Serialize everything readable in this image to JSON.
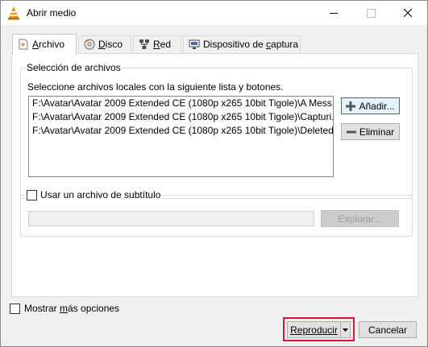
{
  "window": {
    "title": "Abrir medio",
    "icon": "vlc-cone-icon"
  },
  "tabs": [
    {
      "pre": "",
      "mnemonic": "A",
      "post": "rchivo",
      "icon": "file-play-icon",
      "active": true
    },
    {
      "pre": "",
      "mnemonic": "D",
      "post": "isco",
      "icon": "disc-icon",
      "active": false
    },
    {
      "pre": "",
      "mnemonic": "R",
      "post": "ed",
      "icon": "network-icon",
      "active": false
    },
    {
      "pre": "Dispositivo de ",
      "mnemonic": "c",
      "post": "aptura",
      "icon": "capture-device-icon",
      "active": false
    }
  ],
  "file_selection": {
    "legend": "Selección de archivos",
    "instructions": "Seleccione archivos locales con la siguiente lista y botones.",
    "files": [
      "F:\\Avatar\\Avatar 2009 Extended CE (1080p x265 10bit Tigole)\\A Mess...",
      "F:\\Avatar\\Avatar 2009 Extended CE (1080p x265 10bit Tigole)\\Capturi...",
      "F:\\Avatar\\Avatar 2009 Extended CE (1080p x265 10bit Tigole)\\Deleted..."
    ],
    "add_label": "Añadir...",
    "remove_label": "Eliminar"
  },
  "subtitle": {
    "checkbox_label": "Usar un archivo de subtítulo",
    "checked": false,
    "path_value": "",
    "browse_label": "Explorar..."
  },
  "footer": {
    "more_options_pre": "Mostrar ",
    "more_options_mnemonic": "m",
    "more_options_post": "ás opciones",
    "play_label": "Reproducir",
    "cancel_label": "Cancelar"
  },
  "colors": {
    "highlight": "#d6182e",
    "focus": "#0078d7",
    "vlc_orange": "#f18e00"
  }
}
